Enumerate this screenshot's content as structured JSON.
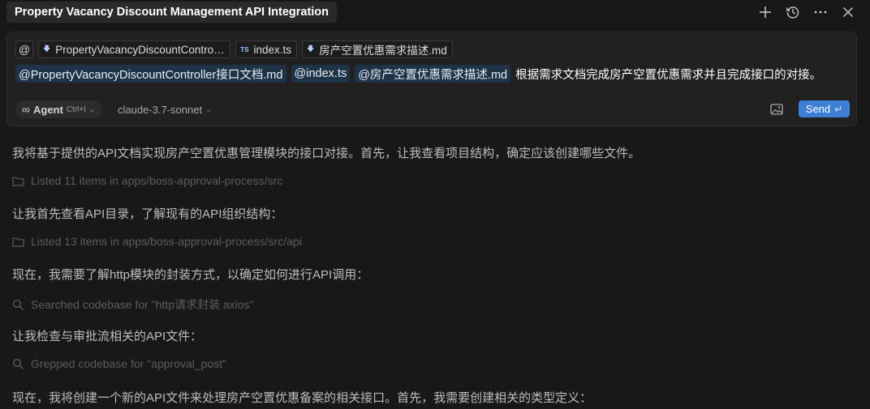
{
  "window": {
    "title": "Property Vacancy Discount Management API Integration",
    "actions": [
      {
        "icon": "plus-icon"
      },
      {
        "icon": "history-icon"
      },
      {
        "icon": "more-icon"
      },
      {
        "icon": "close-icon"
      }
    ]
  },
  "composer": {
    "at_symbol": "@",
    "context_files": [
      {
        "icon": "markdown-icon",
        "label": "PropertyVacancyDiscountControl..."
      },
      {
        "icon": "typescript-icon",
        "icon_text": "TS",
        "label": "index.ts"
      },
      {
        "icon": "markdown-icon",
        "label": "房产空置优惠需求描述.md"
      }
    ],
    "mentions": [
      "@PropertyVacancyDiscountController接口文档.md",
      "@index.ts",
      "@房产空置优惠需求描述.md"
    ],
    "prompt_text": "根据需求文档完成房产空置优惠需求并且完成接口的对接。",
    "mode": {
      "label": "Agent",
      "shortcut": "Ctrl+I",
      "icon": "infinity-icon"
    },
    "model": "claude-3.7-sonnet",
    "send_label": "Send",
    "send_icon": "↵",
    "colors": {
      "send": "#3d7fd4",
      "mention_bg": "#1e3348"
    }
  },
  "messages": [
    {
      "type": "text",
      "text": "我将基于提供的API文档实现房产空置优惠管理模块的接口对接。首先，让我查看项目结构，确定应该创建哪些文件。"
    },
    {
      "type": "tool",
      "icon": "folder-icon",
      "text": "Listed 11 items in apps/boss-approval-process/src"
    },
    {
      "type": "text",
      "text": "让我首先查看API目录，了解现有的API组织结构："
    },
    {
      "type": "tool",
      "icon": "folder-icon",
      "text": "Listed 13 items in apps/boss-approval-process/src/api"
    },
    {
      "type": "text",
      "text": "现在，我需要了解http模块的封装方式，以确定如何进行API调用："
    },
    {
      "type": "tool",
      "icon": "search-icon",
      "text": "Searched codebase for \"http请求封装 axios\""
    },
    {
      "type": "text",
      "text": "让我检查与审批流相关的API文件："
    },
    {
      "type": "tool",
      "icon": "search-icon",
      "text": "Grepped codebase for \"approval_post\""
    },
    {
      "type": "text",
      "text": "现在，我将创建一个新的API文件来处理房产空置优惠备案的相关接口。首先，我需要创建相关的类型定义："
    }
  ]
}
